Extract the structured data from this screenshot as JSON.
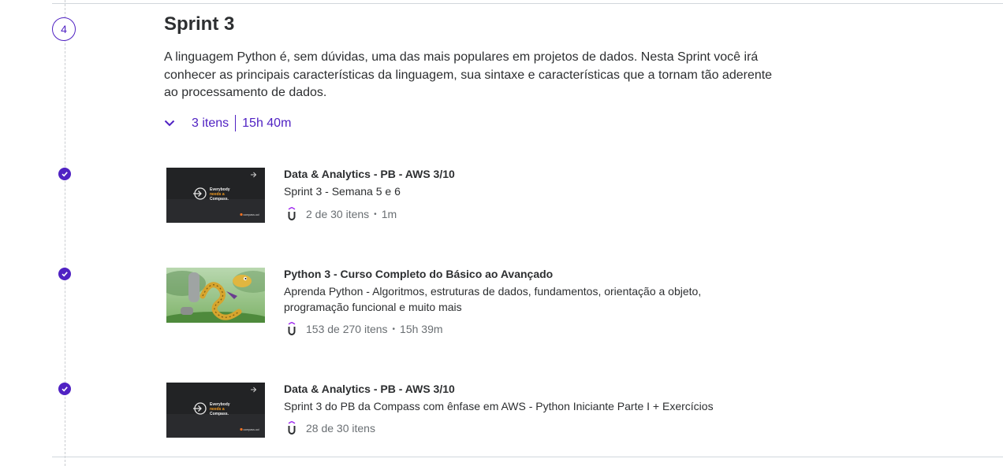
{
  "section": {
    "number": "4",
    "title": "Sprint 3",
    "description": "A linguagem Python é, sem dúvidas, uma das mais populares em projetos de dados. Nesta Sprint você irá conhecer as principais características da linguagem, sua sintaxe e características que a tornam tão aderente ao processamento de dados.",
    "items_count": "3 itens",
    "duration": "15h 40m"
  },
  "thumb_text": {
    "line1": "Everybody",
    "line2": "needs a",
    "line3": "Compass.",
    "brand": "compass.uol"
  },
  "items": [
    {
      "title": "Data & Analytics - PB - AWS 3/10",
      "subtitle": "Sprint 3 - Semana 5 e 6",
      "progress": "2 de 30 itens",
      "duration": "1m",
      "completed": true,
      "thumbnail": "compass-thumbnail"
    },
    {
      "title": "Python 3 - Curso Completo do Básico ao Avançado",
      "subtitle": "Aprenda Python - Algoritmos, estruturas de dados, fundamentos, orientação a objeto, programação funcional e muito mais",
      "progress": "153 de 270 itens",
      "duration": "15h 39m",
      "completed": true,
      "thumbnail": "python-snake-thumbnail"
    },
    {
      "title": "Data & Analytics - PB - AWS 3/10",
      "subtitle": "Sprint 3 do PB da Compass com ênfase em AWS - Python Iniciante Parte I + Exercícios",
      "progress": "28 de 30 itens",
      "completed": true,
      "thumbnail": "compass-thumbnail"
    }
  ],
  "colors": {
    "accent": "#5022c3",
    "text": "#2d2f31",
    "muted": "#6a6f73",
    "divider": "#d1d7dc"
  },
  "icons": {
    "expand": "chevron-down-icon",
    "completed": "check-circle-icon",
    "provider": "udemy-u-icon"
  }
}
